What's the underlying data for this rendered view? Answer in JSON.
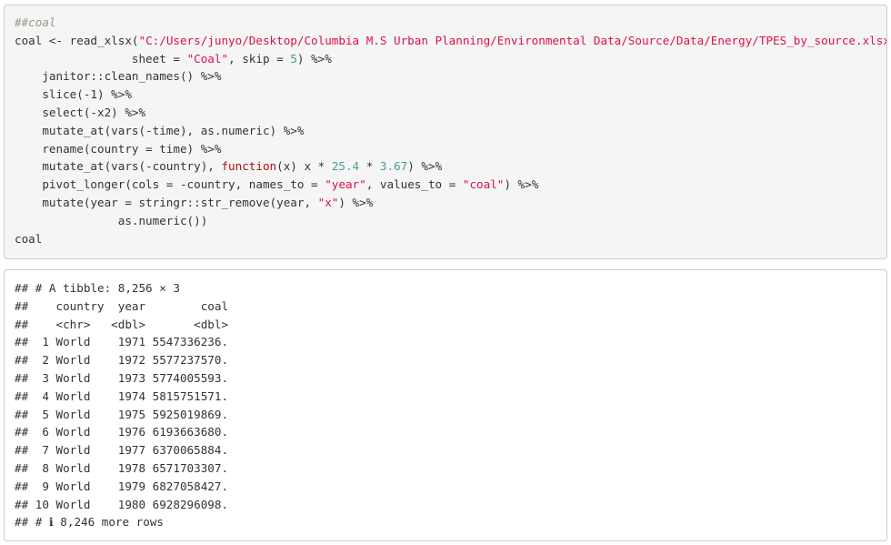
{
  "code": {
    "comment": "##coal",
    "l1_a": "coal <- read_xlsx(",
    "l1_path": "\"C:/Users/junyo/Desktop/Columbia M.S Urban Planning/Environmental Data/Source/Data/Energy/TPES_by_source.xlsx\"",
    "l1_b": ",",
    "l2_a": "                 sheet = ",
    "l2_sheet": "\"Coal\"",
    "l2_b": ", skip = ",
    "l2_skip": "5",
    "l2_c": ") %>%",
    "l3": "    janitor::clean_names() %>%",
    "l4": "    slice(-1) %>%",
    "l5": "    select(-x2) %>%",
    "l6": "    mutate_at(vars(-time), as.numeric) %>%",
    "l7": "    rename(country = time) %>%",
    "l8_a": "    mutate_at(vars(-country), ",
    "l8_kw": "function",
    "l8_b": "(x) x * ",
    "l8_n1": "25.4",
    "l8_c": " * ",
    "l8_n2": "3.67",
    "l8_d": ") %>%",
    "l9_a": "    pivot_longer(cols = -country, names_to = ",
    "l9_s1": "\"year\"",
    "l9_b": ", values_to = ",
    "l9_s2": "\"coal\"",
    "l9_c": ") %>%",
    "l10_a": "    mutate(year = stringr::str_remove(year, ",
    "l10_s": "\"x\"",
    "l10_b": ") %>%",
    "l11": "               as.numeric())",
    "l12": "coal"
  },
  "output": {
    "lines": [
      "## # A tibble: 8,256 × 3",
      "##    country  year        coal",
      "##    <chr>   <dbl>       <dbl>",
      "##  1 World    1971 5547336236.",
      "##  2 World    1972 5577237570.",
      "##  3 World    1973 5774005593.",
      "##  4 World    1974 5815751571.",
      "##  5 World    1975 5925019869.",
      "##  6 World    1976 6193663680.",
      "##  7 World    1977 6370065884.",
      "##  8 World    1978 6571703307.",
      "##  9 World    1979 6827058427.",
      "## 10 World    1980 6928296098.",
      "## # ℹ 8,246 more rows"
    ]
  },
  "colors": {
    "code_bg": "#f5f5f5",
    "border": "#cccccc",
    "string": "#dd1144",
    "number": "#4a9a9a",
    "keyword": "#aa1111",
    "comment": "#999988"
  }
}
